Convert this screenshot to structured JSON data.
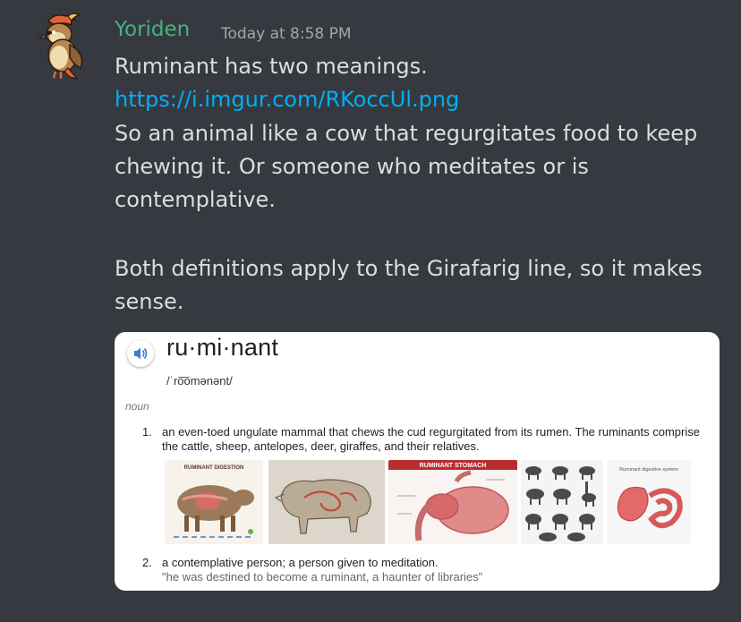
{
  "message": {
    "username": "Yoriden",
    "timestamp": "Today at 8:58 PM",
    "avatar_icon": "pidgeotto-avatar",
    "lines": [
      "Ruminant has two meanings.",
      "So an animal like a cow that regurgitates food to keep",
      "chewing it. Or someone who meditates or is",
      "contemplative.",
      "Both definitions apply to the Girafarig line, so it makes",
      "sense."
    ],
    "link": "https://i.imgur.com/RKoccUl.png"
  },
  "embed": {
    "word": "ru·mi·nant",
    "phonetic": "/ˈro͞omənənt/",
    "part_of_speech": "noun",
    "speaker_icon": "speaker-icon",
    "definitions": [
      {
        "number": "1.",
        "text": "an even-toed ungulate mammal that chews the cud regurgitated from its rumen. The ruminants comprise the cattle, sheep, antelopes, deer, giraffes, and their relatives."
      },
      {
        "number": "2.",
        "text": "a contemplative person; a person given to meditation.",
        "example": "\"he was destined to become a ruminant, a haunter of libraries\""
      }
    ],
    "images": [
      {
        "name": "ruminant-digestion-diagram",
        "label": "RUMINANT DIGESTION"
      },
      {
        "name": "ruminant-sketch-image",
        "label": ""
      },
      {
        "name": "ruminant-stomach-diagram",
        "label": "RUMINANT STOMACH"
      },
      {
        "name": "ruminant-animals-image",
        "label": ""
      },
      {
        "name": "ruminant-digestive-system-image",
        "label": "Ruminant digestive system"
      }
    ]
  },
  "colors": {
    "background": "#36393f",
    "username": "#43b581",
    "text": "#dcddde",
    "link": "#00aff4",
    "timestamp": "#a3a6aa"
  }
}
